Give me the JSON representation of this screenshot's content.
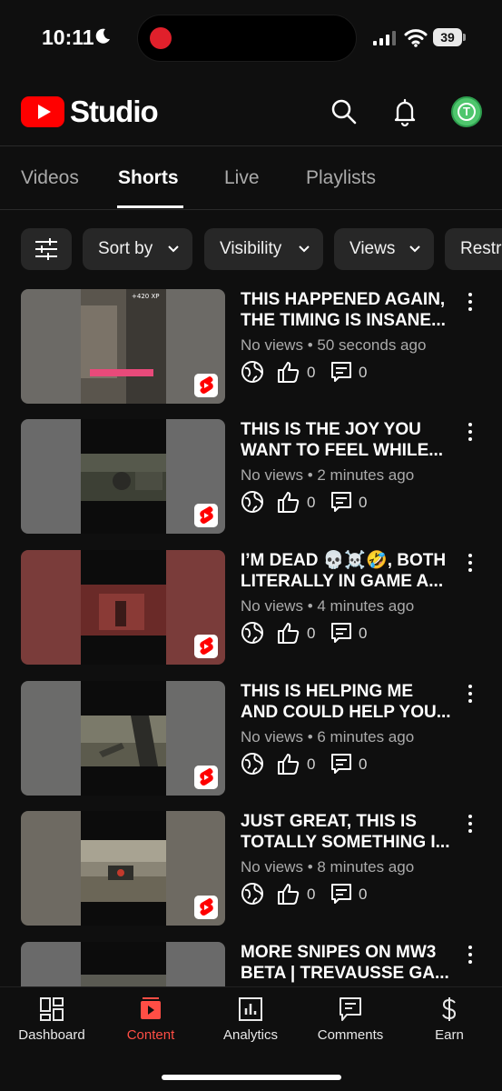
{
  "status_bar": {
    "time": "10:11",
    "battery": "39"
  },
  "header": {
    "logo_text": "Studio"
  },
  "tabs": [
    {
      "label": "Videos",
      "active": false
    },
    {
      "label": "Shorts",
      "active": true
    },
    {
      "label": "Live",
      "active": false
    },
    {
      "label": "Playlists",
      "active": false
    }
  ],
  "filters": [
    {
      "label": "Sort by"
    },
    {
      "label": "Visibility"
    },
    {
      "label": "Views"
    },
    {
      "label": "Restr"
    }
  ],
  "videos": [
    {
      "title_line1": "THIS HAPPENED AGAIN,",
      "title_line2": "THE TIMING IS INSANE...",
      "views": "No views",
      "time": "50 seconds ago",
      "likes": "0",
      "comments": "0",
      "thumb_color": "#6c6a66"
    },
    {
      "title_line1": "THIS IS THE JOY YOU",
      "title_line2": "WANT TO FEEL WHILE...",
      "views": "No views",
      "time": "2 minutes ago",
      "likes": "0",
      "comments": "0",
      "thumb_color": "#6a6a6a"
    },
    {
      "title_line1": "I’M DEAD 💀☠️🤣, BOTH",
      "title_line2": "LITERALLY IN GAME A...",
      "views": "No views",
      "time": "4 minutes ago",
      "likes": "0",
      "comments": "0",
      "thumb_color": "#7a3c3a"
    },
    {
      "title_line1": "THIS IS HELPING ME",
      "title_line2": "AND COULD HELP YOU...",
      "views": "No views",
      "time": "6 minutes ago",
      "likes": "0",
      "comments": "0",
      "thumb_color": "#6b6b6a"
    },
    {
      "title_line1": "JUST GREAT, THIS IS",
      "title_line2": "TOTALLY SOMETHING I...",
      "views": "No views",
      "time": "8 minutes ago",
      "likes": "0",
      "comments": "0",
      "thumb_color": "#6e6a62"
    },
    {
      "title_line1": "MORE SNIPES ON MW3",
      "title_line2": "BETA | TREVAUSSE GA...",
      "views": "",
      "time": "",
      "likes": "",
      "comments": "",
      "thumb_color": "#6a6a6a"
    }
  ],
  "bottom_nav": [
    {
      "label": "Dashboard",
      "icon": "dashboard-icon",
      "active": false
    },
    {
      "label": "Content",
      "icon": "content-icon",
      "active": true
    },
    {
      "label": "Analytics",
      "icon": "analytics-icon",
      "active": false
    },
    {
      "label": "Comments",
      "icon": "comments-icon",
      "active": false
    },
    {
      "label": "Earn",
      "icon": "earn-icon",
      "active": false
    }
  ],
  "colors": {
    "background": "#0f0f0f",
    "brand_red": "#ff0000",
    "active_nav": "#ff4e45",
    "chip_bg": "#272727"
  }
}
